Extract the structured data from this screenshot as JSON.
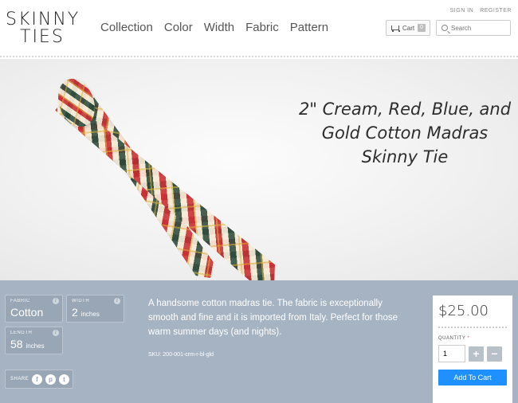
{
  "logo": {
    "line1": "SKINNY",
    "line2": "TIES"
  },
  "nav": [
    "Collection",
    "Color",
    "Width",
    "Fabric",
    "Pattern"
  ],
  "account": {
    "sign_in": "SIGN IN",
    "register": "REGISTER"
  },
  "cart": {
    "label": "Cart",
    "count": "0"
  },
  "search": {
    "placeholder": "Search"
  },
  "hero": {
    "title": "2\" Cream, Red, Blue, and Gold Cotton Madras Skinny Tie"
  },
  "attributes": {
    "fabric": {
      "label": "FABRIC",
      "value": "Cotton"
    },
    "width": {
      "label": "WIDTH",
      "value": "2",
      "unit": "inches"
    },
    "length": {
      "label": "LENGTH",
      "value": "58",
      "unit": "inches"
    }
  },
  "share": {
    "label": "SHARE"
  },
  "product": {
    "description": "A handsome cotton madras tie. The fabric is exceptionally smooth and fine and it is imported from Italy. Perfect for those warm summer days (and nights).",
    "sku": "SKU: 200-001-crm-r-bl-gld",
    "price": "$25.00",
    "quantity_label": "QUANTITY",
    "quantity_required": "*",
    "quantity": "1",
    "add_to_cart": "Add To Cart"
  },
  "colors": {
    "accent": "#1e90ff",
    "details_bg": "#a6b3c2"
  }
}
